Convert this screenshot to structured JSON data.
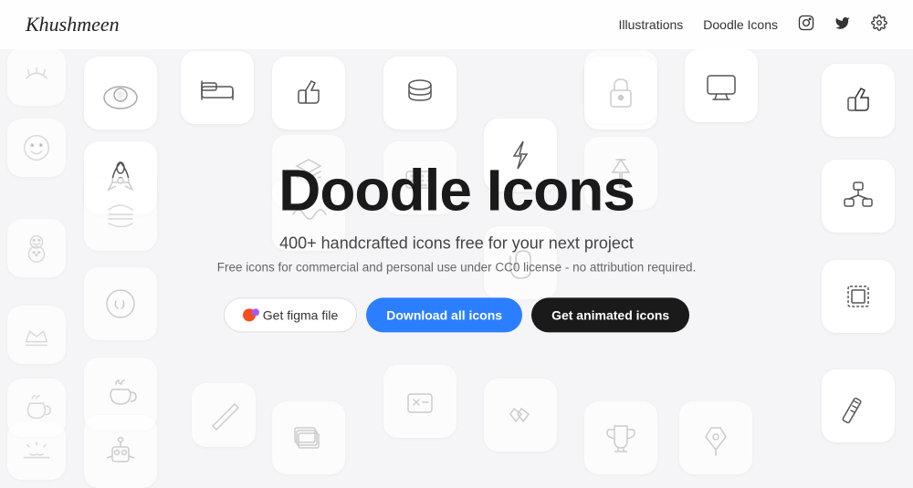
{
  "header": {
    "logo": "Khushmeen",
    "nav": {
      "illustrations": "Illustrations",
      "doodle_icons": "Doodle Icons"
    }
  },
  "hero": {
    "title": "Doodle Icons",
    "subtitle": "400+ handcrafted icons free for your next project",
    "description": "Free icons for commercial and personal use under CC0 license - no attribution required.",
    "btn_figma": "Get figma file",
    "btn_download": "Download all icons",
    "btn_animated": "Get animated icons"
  }
}
